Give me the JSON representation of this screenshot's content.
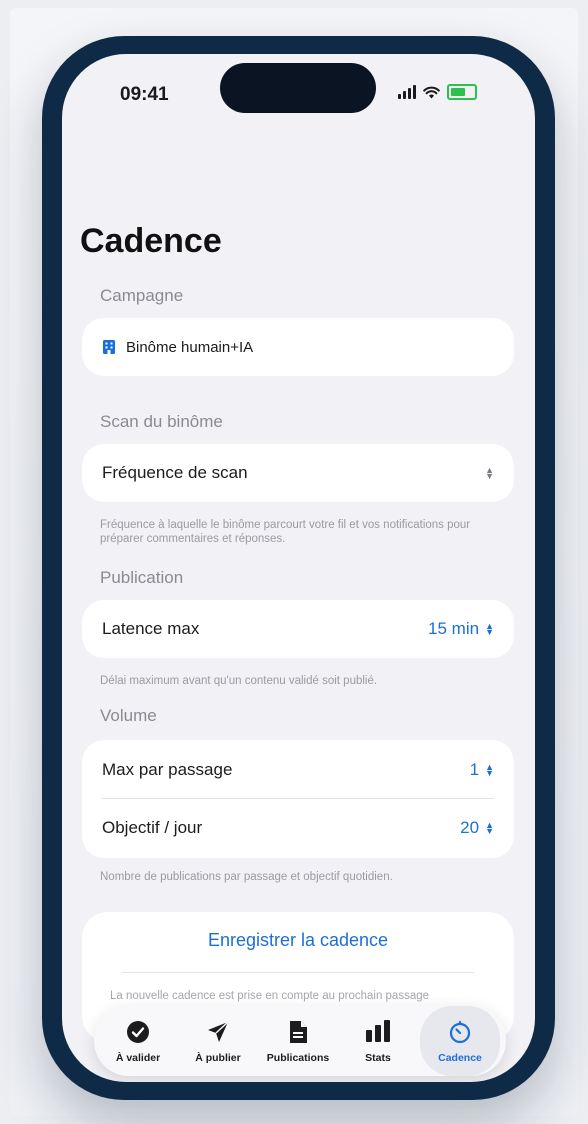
{
  "status_bar": {
    "time": "09:41"
  },
  "page": {
    "title": "Cadence"
  },
  "campaign": {
    "section_label": "Campagne",
    "value": "Binôme humain+IA"
  },
  "scan": {
    "section_label": "Scan du binôme",
    "row_label": "Fréquence de scan",
    "hint": "Fréquence à laquelle le binôme parcourt votre fil et vos notifications pour préparer commentaires et réponses."
  },
  "publication": {
    "section_label": "Publication",
    "row_label": "Latence max",
    "row_value": "15 min",
    "hint": "Délai maximum avant qu'un contenu validé soit publié."
  },
  "volume": {
    "section_label": "Volume",
    "rows": [
      {
        "label": "Max par passage",
        "value": "1"
      },
      {
        "label": "Objectif / jour",
        "value": "20"
      }
    ],
    "hint": "Nombre de publications par passage et objectif quotidien."
  },
  "save": {
    "button_label": "Enregistrer la cadence",
    "note": "La nouvelle cadence est prise en compte au prochain passage"
  },
  "tabbar": {
    "tabs": [
      {
        "label": "À valider",
        "icon": "checkmark-circle-icon"
      },
      {
        "label": "À publier",
        "icon": "paperplane-icon"
      },
      {
        "label": "Publications",
        "icon": "document-icon"
      },
      {
        "label": "Stats",
        "icon": "bar-chart-icon"
      },
      {
        "label": "Cadence",
        "icon": "timer-icon"
      }
    ],
    "active": "Cadence"
  },
  "colors": {
    "accent": "#1a6fd8",
    "frame": "#0f2a47",
    "background": "#f1f1f6"
  }
}
